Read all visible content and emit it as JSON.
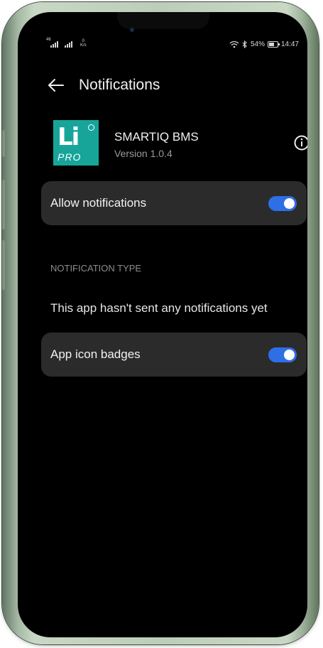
{
  "status_bar": {
    "signal_1": "46",
    "speed_value": "0",
    "speed_unit": "K/s",
    "battery": "54%",
    "time": "14:47"
  },
  "header": {
    "title": "Notifications"
  },
  "app": {
    "logo_text": "Li",
    "logo_subtext": "PRO",
    "name": "SMARTIQ BMS",
    "version": "Version 1.0.4"
  },
  "settings": {
    "allow_notifications": {
      "label": "Allow notifications",
      "enabled": true
    },
    "section_title": "NOTIFICATION TYPE",
    "empty_message": "This app hasn't sent any notifications yet",
    "app_icon_badges": {
      "label": "App icon badges",
      "enabled": true
    }
  },
  "colors": {
    "toggle_on": "#2f6fe6",
    "card_bg": "#2b2b2b",
    "logo_bg": "#17a59a",
    "frame": "#bccdb9"
  },
  "icons": {
    "back": "arrow-left-icon",
    "info": "info-circle-icon",
    "signal": "signal-icon",
    "wifi": "wifi-icon",
    "bluetooth": "bluetooth-icon",
    "battery": "battery-icon"
  }
}
